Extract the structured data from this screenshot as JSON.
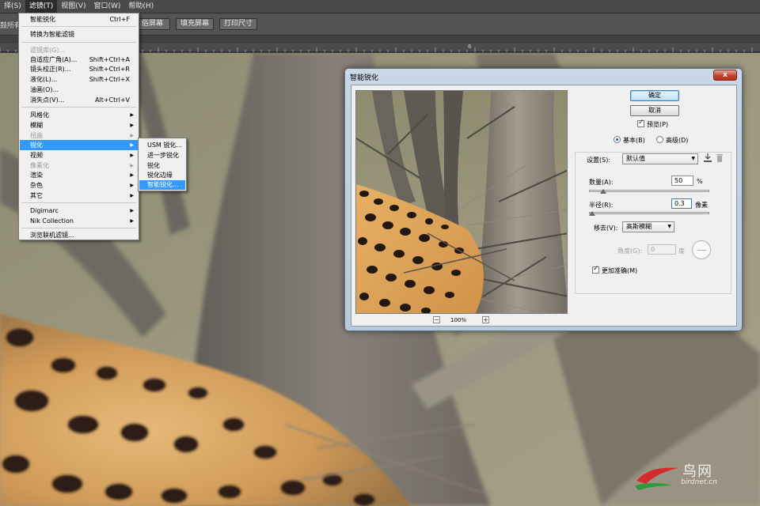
{
  "menubar": {
    "items": [
      {
        "label": "择(S)"
      },
      {
        "label": "滤镜(T)",
        "active": true
      },
      {
        "label": "视图(V)"
      },
      {
        "label": "窗口(W)"
      },
      {
        "label": "帮助(H)"
      }
    ]
  },
  "options_bar": {
    "left_label": "鼓所有",
    "buttons": [
      "俗屏幕",
      "填充屏幕",
      "打印尺寸"
    ]
  },
  "ruler": {
    "tick_number": "6"
  },
  "filter_menu": {
    "items": [
      {
        "label": "智能锐化",
        "shortcut": "Ctrl+F"
      },
      {
        "label": "转换为智能滤镜"
      },
      {
        "label": "滤镜库(G)...",
        "disabled": true
      },
      {
        "label": "自适应广角(A)...",
        "shortcut": "Shift+Ctrl+A"
      },
      {
        "label": "镜头校正(R)...",
        "shortcut": "Shift+Ctrl+R"
      },
      {
        "label": "液化(L)...",
        "shortcut": "Shift+Ctrl+X"
      },
      {
        "label": "油画(O)..."
      },
      {
        "label": "消失点(V)...",
        "shortcut": "Alt+Ctrl+V"
      },
      {
        "label": "风格化",
        "submenu": true
      },
      {
        "label": "模糊",
        "submenu": true
      },
      {
        "label": "扭曲",
        "submenu": true,
        "disabled": true
      },
      {
        "label": "锐化",
        "submenu": true,
        "highlighted": true
      },
      {
        "label": "视频",
        "submenu": true
      },
      {
        "label": "像素化",
        "submenu": true,
        "disabled": true
      },
      {
        "label": "渲染",
        "submenu": true
      },
      {
        "label": "杂色",
        "submenu": true
      },
      {
        "label": "其它",
        "submenu": true
      },
      {
        "label": "Digimarc",
        "submenu": true
      },
      {
        "label": "Nik Collection",
        "submenu": true
      },
      {
        "label": "浏览联机滤镜..."
      }
    ]
  },
  "sharpen_submenu": {
    "items": [
      {
        "label": "USM 锐化..."
      },
      {
        "label": "进一步锐化"
      },
      {
        "label": "锐化"
      },
      {
        "label": "锐化边缘"
      },
      {
        "label": "智能锐化...",
        "highlighted": true
      }
    ]
  },
  "dialog": {
    "title": "智能锐化",
    "close_label": "x",
    "ok_label": "确定",
    "cancel_label": "取消",
    "preview_label": "预览(P)",
    "preview_checked": true,
    "mode_basic_label": "基本(B)",
    "mode_advanced_label": "高级(D)",
    "mode_selected": "basic",
    "settings_label": "设置(S):",
    "settings_value": "默认值",
    "amount_label": "数量(A):",
    "amount_value": "50",
    "amount_unit": "%",
    "amount_fraction": 0.1,
    "radius_label": "半径(R):",
    "radius_value": "0.3",
    "radius_unit": "像素",
    "radius_fraction": 0.0,
    "remove_label": "移去(V):",
    "remove_value": "高斯模糊",
    "angle_label": "角度(G):",
    "angle_value": "0",
    "angle_unit": "度",
    "more_accurate_label": "更加准确(M)",
    "more_accurate_checked": true,
    "zoom_minus": "−",
    "zoom_plus": "+",
    "zoom_level": "100%"
  },
  "watermark": {
    "title": "鸟网",
    "url": "birdnet.cn"
  }
}
